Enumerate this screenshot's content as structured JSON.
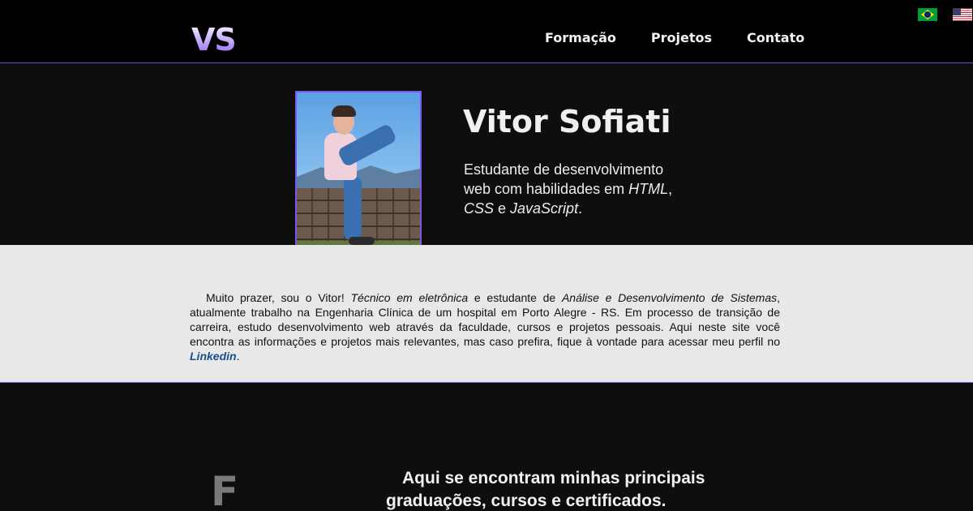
{
  "header": {
    "logo": "VS",
    "nav": [
      "Formação",
      "Projetos",
      "Contato"
    ],
    "languages": [
      "Português (Brasil)",
      "English (US)"
    ]
  },
  "hero": {
    "name": "Vitor Sofiati",
    "tagline_parts": [
      "Estudante de desenvolvimento web com habilidades em ",
      "HTML",
      ", ",
      "CSS",
      " e ",
      "JavaScript",
      "."
    ]
  },
  "about": {
    "p1": "Muito prazer, sou o Vitor! ",
    "p2": "Técnico em eletrônica",
    "p3": " e estudante de ",
    "p4": "Análise e Desenvolvimento de Sistemas",
    "p5": ", atualmente trabalho na Engenharia Clínica de um hospital em Porto Alegre - RS. Em processo de transição de carreira, estudo desenvolvimento web através da faculdade, cursos e projetos pessoais. Aqui neste site você encontra as informações e projetos mais relevantes, mas caso prefira, fique à vontade para acessar meu perfil no ",
    "link": "Linkedin",
    "p6": "."
  },
  "formacao": {
    "letter": "F",
    "text": "Aqui se encontram minhas principais graduações, cursos e certificados."
  },
  "colors": {
    "accent": "#7d56ea",
    "header_bg": "#000000",
    "section_bg": "#0e0e0f",
    "about_bg": "#e8e8e8",
    "link": "#1b4f8a"
  }
}
